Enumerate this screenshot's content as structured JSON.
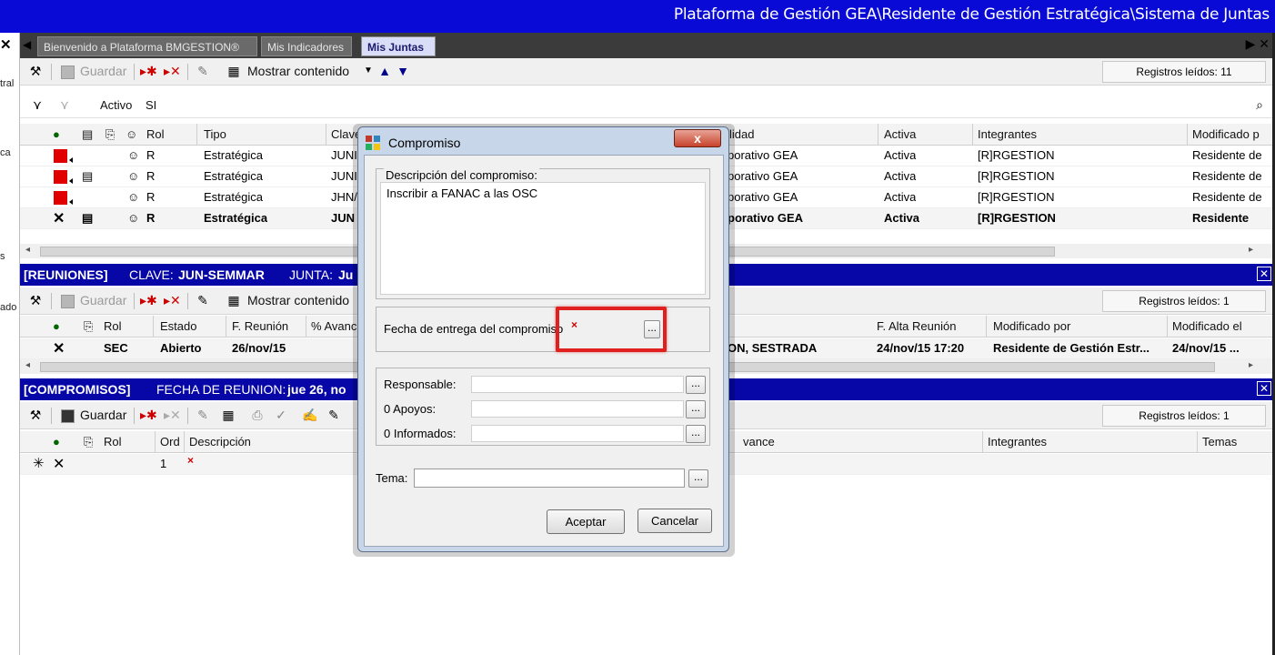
{
  "window": {
    "title": "Plataforma de Gestión GEA\\Residente de Gestión Estratégica\\Sistema de Juntas"
  },
  "left_strip": [
    "tral",
    "ca",
    "s",
    "ado"
  ],
  "tabs": [
    {
      "label": "Bienvenido a Plataforma BMGESTION®",
      "active": false
    },
    {
      "label": "Mis Indicadores",
      "active": false
    },
    {
      "label": "Mis Juntas",
      "active": true
    }
  ],
  "juntas": {
    "toolbar": {
      "save_label": "Guardar",
      "show_content_label": "Mostrar contenido",
      "records": "Registros leídos:  11"
    },
    "filter": {
      "label": "Activo",
      "value": "SI"
    },
    "columns": [
      "Rol",
      "Tipo",
      "Clave",
      "lidad",
      "Activa",
      "Integrantes",
      "Modificado p"
    ],
    "rows": [
      {
        "rol": "R",
        "tipo": "Estratégica",
        "clave": "JUNI",
        "entidad": "porativo GEA",
        "activa": "Activa",
        "integrantes": "[R]RGESTION",
        "modificado": "Residente de"
      },
      {
        "rol": "R",
        "tipo": "Estratégica",
        "clave": "JUNI",
        "entidad": "porativo GEA",
        "activa": "Activa",
        "integrantes": "[R]RGESTION",
        "modificado": "Residente de"
      },
      {
        "rol": "R",
        "tipo": "Estratégica",
        "clave": "JHN/",
        "entidad": "porativo GEA",
        "activa": "Activa",
        "integrantes": "[R]RGESTION",
        "modificado": "Residente de"
      },
      {
        "rol": "R",
        "tipo": "Estratégica",
        "clave": "JUN",
        "entidad": "porativo GEA",
        "activa": "Activa",
        "integrantes": "[R]RGESTION",
        "modificado": "Residente"
      }
    ]
  },
  "reuniones": {
    "header": {
      "title": "[REUNIONES]",
      "clave_label": "CLAVE:",
      "clave_value": "JUN-SEMMAR",
      "junta_label": "JUNTA:",
      "junta_value": "Ju"
    },
    "toolbar": {
      "save_label": "Guardar",
      "show_content_label": "Mostrar contenido",
      "records": "Registros leídos:  1"
    },
    "columns": [
      "Rol",
      "Estado",
      "F. Reunión",
      "% Avanc",
      "F. Alta Reunión",
      "Modificado por",
      "Modificado el"
    ],
    "row": {
      "rol": "SEC",
      "estado": "Abierto",
      "fecha": "26/nov/15",
      "participantes": "ON, SESTRADA",
      "alta": "24/nov/15  17:20",
      "modificado_por": "Residente de Gestión Estr...",
      "modificado_el": "24/nov/15 ..."
    }
  },
  "compromisos": {
    "header": {
      "title": "[COMPROMISOS]",
      "fecha_label": "FECHA DE REUNION:",
      "fecha_value": "jue 26, no"
    },
    "toolbar": {
      "save_label": "Guardar",
      "records": "Registros leídos:  1"
    },
    "columns": [
      "Rol",
      "Ord",
      "Descripción",
      "vance",
      "Integrantes",
      "Temas"
    ],
    "row": {
      "ord": "1"
    }
  },
  "dialog": {
    "title": "Compromiso",
    "close_glyph": "x",
    "descripcion_label": "Descripción del compromiso:",
    "descripcion_value": "Inscribir a FANAC a las OSC",
    "fecha_label": "Fecha de entrega del compromiso",
    "responsable_label": "Responsable:",
    "apoyos_label": "0 Apoyos:",
    "informados_label": "0 Informados:",
    "tema_label": "Tema:",
    "accept_label": "Aceptar",
    "cancel_label": "Cancelar",
    "dots": "..."
  },
  "colors": {
    "titlebar": "#0a0ad6",
    "section_bar": "#0707a8",
    "highlight": "#e01f1f"
  }
}
